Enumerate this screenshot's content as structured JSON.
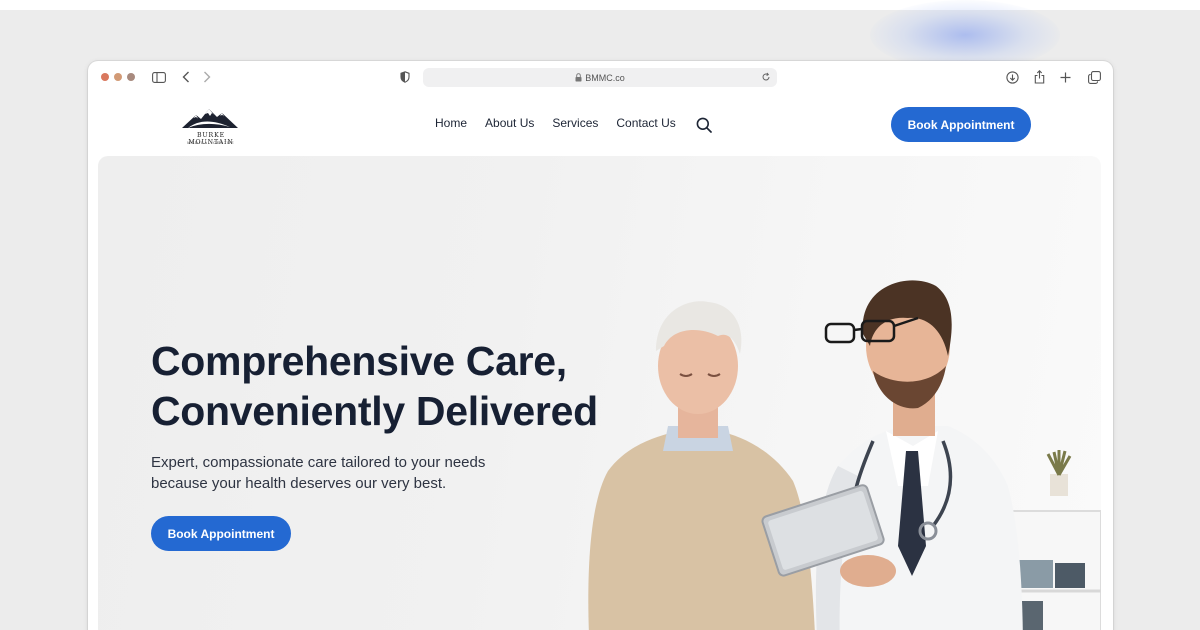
{
  "browser": {
    "url": "BMMC.co"
  },
  "logo": {
    "name": "BURKE MOUNTAIN",
    "subtitle": "MEDICAL CENTRE"
  },
  "nav": {
    "items": [
      {
        "label": "Home"
      },
      {
        "label": "About Us"
      },
      {
        "label": "Services"
      },
      {
        "label": "Contact Us"
      }
    ]
  },
  "header": {
    "cta_label": "Book Appointment"
  },
  "hero": {
    "title_line1": "Comprehensive Care,",
    "title_line2": "Conveniently Delivered",
    "subtitle_line1": "Expert, compassionate care tailored to your needs",
    "subtitle_line2": "because your health deserves our very best.",
    "cta_label": "Book Appointment",
    "image": "doctor-and-elderly-patient-photo"
  },
  "colors": {
    "accent": "#2469d2",
    "heading": "#172033",
    "background": "#ececec"
  }
}
